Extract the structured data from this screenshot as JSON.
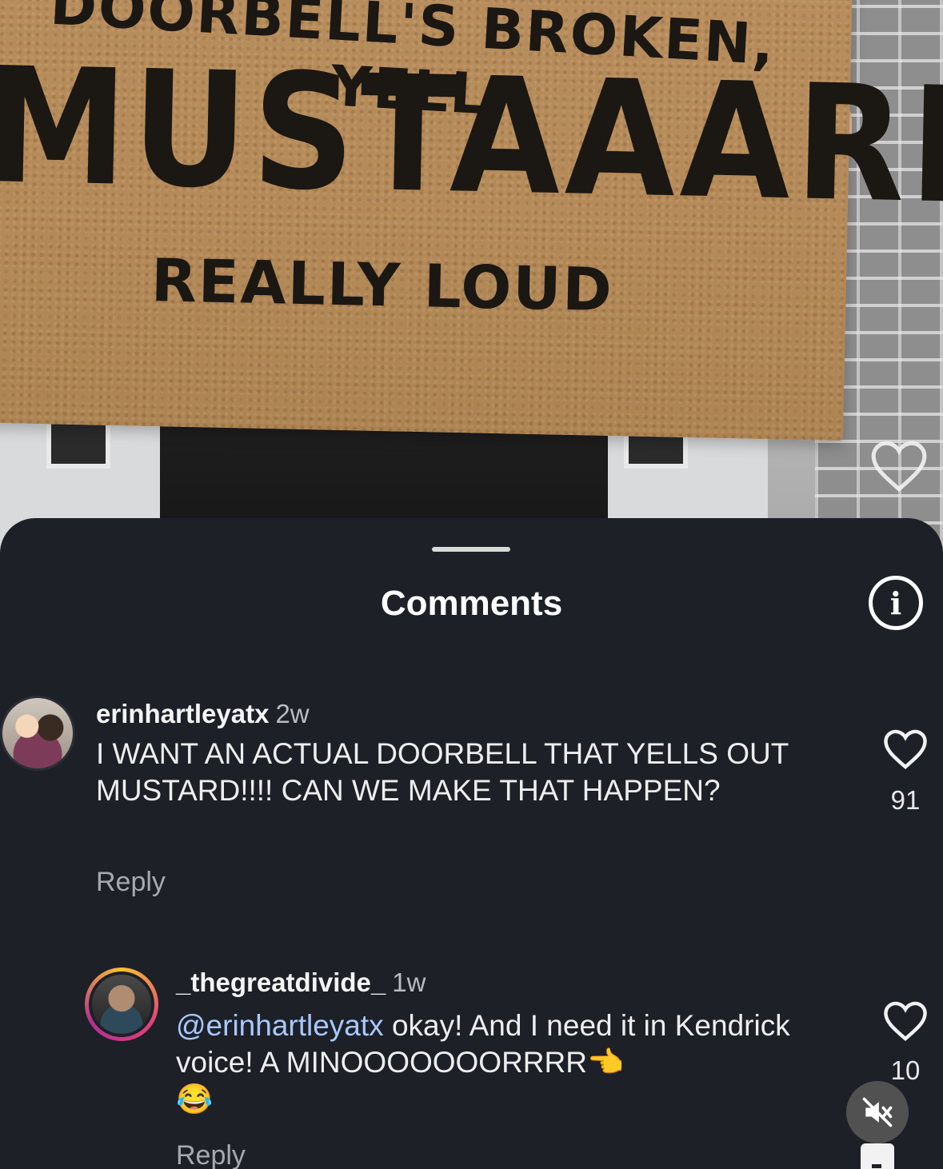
{
  "photo": {
    "mat_line1": "DOORBELL'S BROKEN, YELL",
    "mat_line2": "MUSTAAARD",
    "mat_line3": "REALLY LOUD"
  },
  "sheet": {
    "title": "Comments",
    "info_icon": "i"
  },
  "comments": [
    {
      "username": "erinhartleyatx",
      "time": "2w",
      "text": "I WANT AN ACTUAL DOORBELL THAT YELLS OUT MUSTARD!!!! CAN WE MAKE THAT HAPPEN?",
      "reply_label": "Reply",
      "likes": "91"
    },
    {
      "username": "_thegreatdivide_",
      "time": "1w",
      "mention": "@erinhartleyatx",
      "text": " okay! And I need it in Kendrick voice! A MINOOOOOOORRRR",
      "emoji_pointing": "👈",
      "emoji_laugh": "😂",
      "reply_label": "Reply",
      "likes": "10"
    }
  ],
  "icons": {
    "like": "heart-icon",
    "info": "info-icon",
    "mute": "speaker-muted-icon"
  },
  "colors": {
    "sheet_bg": "#1d2027",
    "mention": "#a8c8ff"
  }
}
